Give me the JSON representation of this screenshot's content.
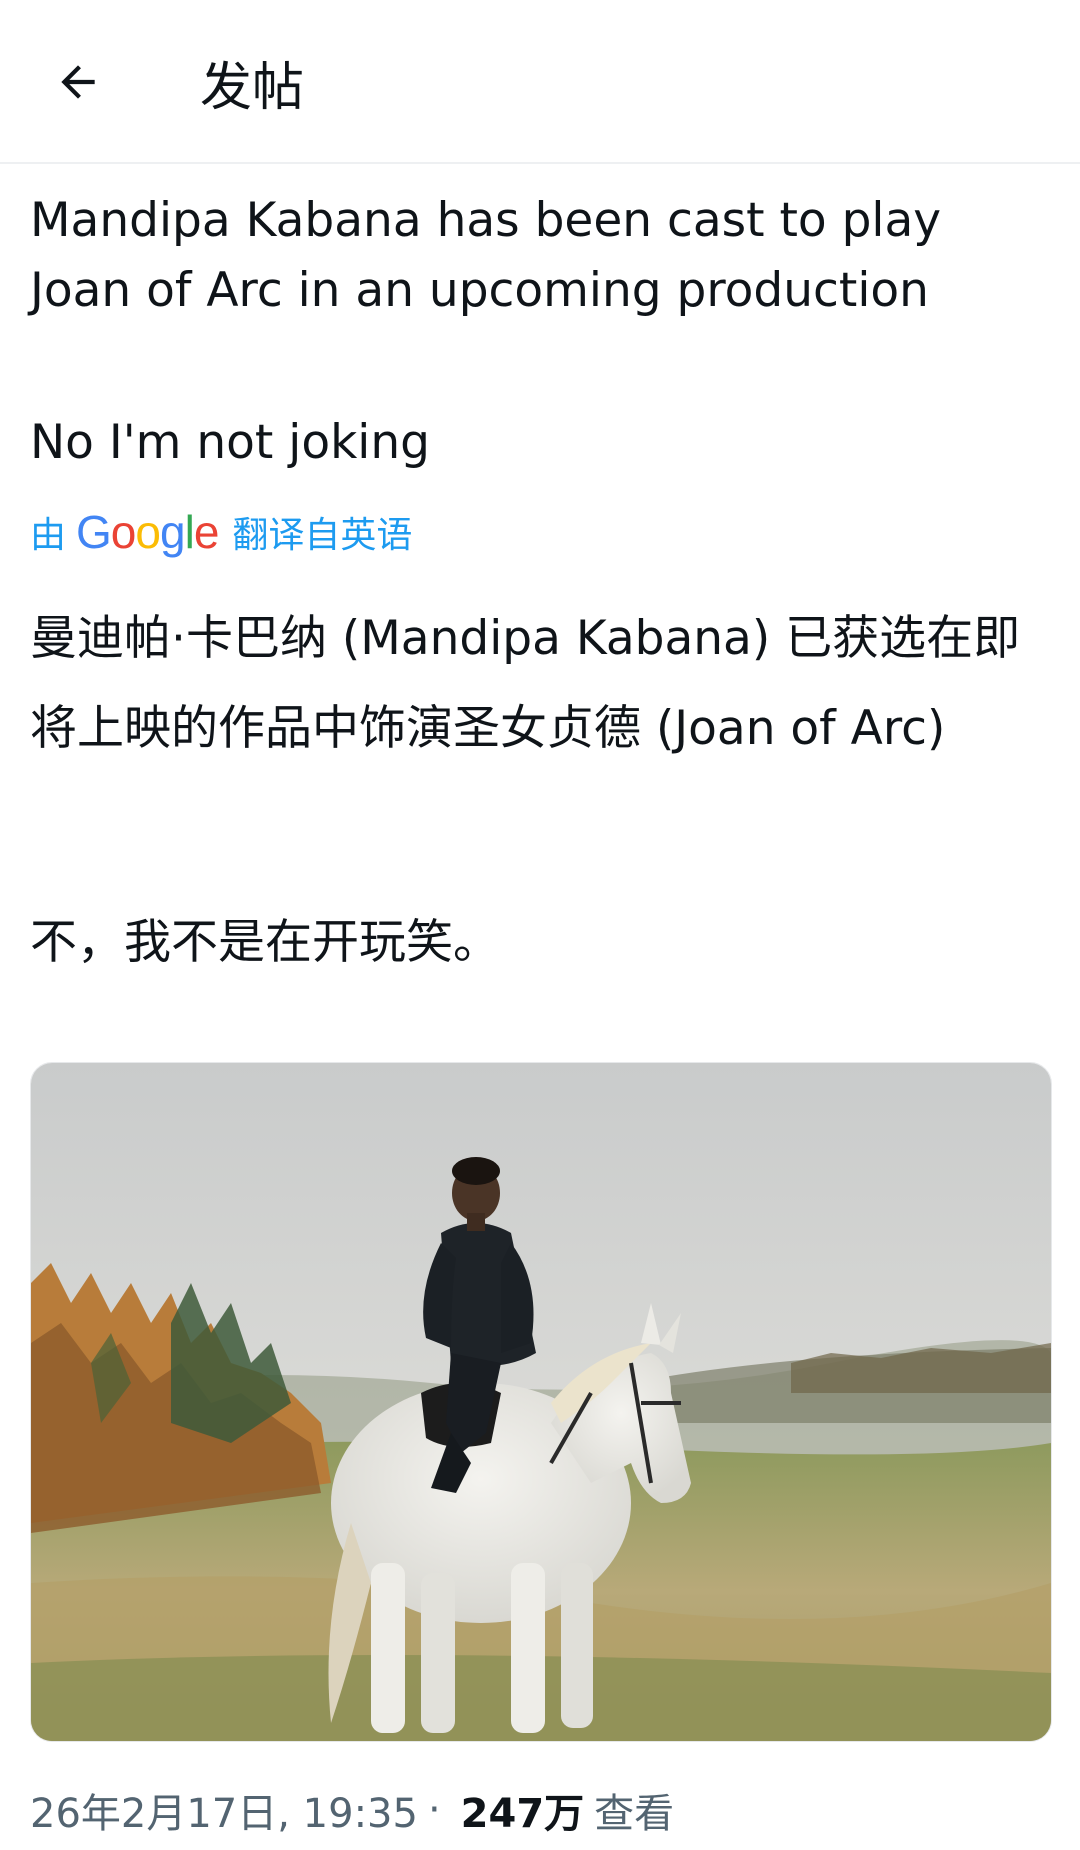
{
  "header": {
    "back_icon": "arrow-left-icon",
    "title": "发帖"
  },
  "post": {
    "text_en_1": "Mandipa Kabana has been cast to play Joan of Arc in an upcoming production",
    "text_en_2": "No I'm not joking",
    "translate": {
      "prefix": "由",
      "brand": "Google",
      "suffix": "翻译自英语"
    },
    "text_zh_1": "曼迪帕·卡巴纳 (Mandipa Kabana) 已获选在即将上映的作品中饰演圣女贞德 (Joan of Arc)",
    "text_zh_2": "不，我不是在开玩笑。",
    "media": {
      "icon": "photo-woman-on-white-horse"
    },
    "meta": {
      "timestamp": "26年2月17日, 19:35",
      "separator": "·",
      "views_count": "247万",
      "views_label": "查看"
    }
  },
  "colors": {
    "text": "#0f1419",
    "muted": "#536471",
    "link": "#1d9bf0",
    "divider": "#eef0f2"
  }
}
